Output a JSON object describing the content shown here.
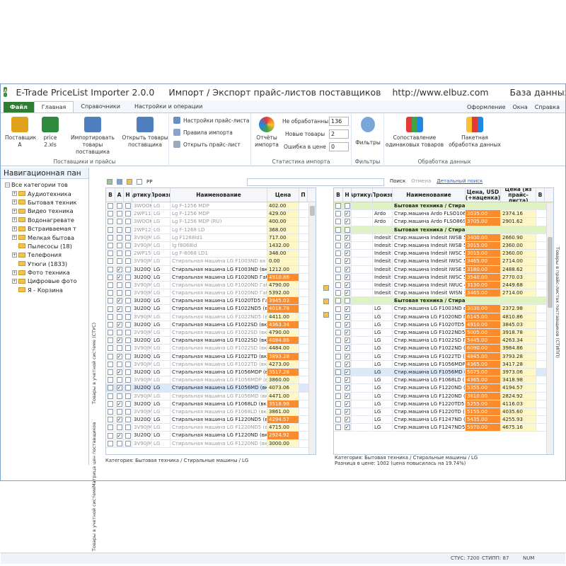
{
  "title": {
    "app": "E-Trade PriceList Importer 2.0.0",
    "subtitle": "Импорт / Экспорт прайс-листов поставщиков",
    "url": "http://www.elbuz.com",
    "db": "База данных: DE"
  },
  "tabs": {
    "file": "Файл",
    "main": "Главная",
    "ref": "Справочники",
    "settings": "Настройки и операции"
  },
  "rightmenu": {
    "design": "Оформление",
    "windows": "Окна",
    "help": "Справка"
  },
  "ribbon": {
    "g1": {
      "label": "Поставщики и прайсы",
      "supplier": "Поставщик",
      "supplier2": "А",
      "price": "price",
      "price2": "2.xls",
      "import": "Импортировать",
      "import2": "товары поставщика",
      "open": "Открыть товары",
      "open2": "поставщика"
    },
    "g2": {
      "label": "",
      "s1": "Настройки прайс-листа",
      "s2": "Правила импорта",
      "s3": "Открыть прайс-лист"
    },
    "g3": {
      "label": "Статистика импорта",
      "reports": "Отчёты",
      "reports2": "импорта",
      "n1": "Не обработанны",
      "v1": "136",
      "n2": "Новые товары",
      "v2": "2",
      "n3": "Ошибка в цене",
      "v3": "0"
    },
    "g4": {
      "label": "Фильтры",
      "filters": "Фильтры"
    },
    "g5": {
      "label": "Обработка данных",
      "compare": "Сопоставление",
      "compare2": "одинаковых товаров",
      "batch": "Пакетная",
      "batch2": "обработка данных"
    }
  },
  "nav": {
    "header": "Навигационная пан",
    "items": [
      "Все категории тов",
      "Аудиотехника",
      "Бытовая техник",
      "Видео техника",
      "Водонагревате",
      "Встраиваемая т",
      "Мелкая бытова",
      "Пылесосы (18)",
      "Телефония",
      "Утюги (1833)",
      "Фото техника",
      "Цифровые фото",
      "Я - Корзина"
    ]
  },
  "vtabs": {
    "t1": "Товары в учетной системе (СТУС)",
    "t2": "Матрица цен поставщиков",
    "t3": "Товары в учетной системе",
    "t4": "Товары в прайс-листах поставщиков (СТИПП)"
  },
  "left": {
    "pp": "PP",
    "headers": {
      "v": "В",
      "a": "А",
      "n": "Н",
      "art": "Артикул",
      "prod": "Произв",
      "name": "Наименование",
      "price": "Цена",
      "p": "П"
    },
    "rows": [
      [
        "3WOOKG",
        "LG",
        "Lg F-1256 MDP",
        "402.00",
        "g"
      ],
      [
        "2WP11Q",
        "LG",
        "Lg F-1256 MDP",
        "429.00",
        "g"
      ],
      [
        "3WOOKG",
        "LG",
        "Lg F-1256 MDP (RU)",
        "400.00",
        "g"
      ],
      [
        "2WP125",
        "LG",
        "Lg F-1268 LD",
        "368.00",
        "g"
      ],
      [
        "3V90JM",
        "LG",
        "Lg F1268ld1",
        "717.00",
        "g"
      ],
      [
        "3V90JM",
        "LG",
        "lg f8068ld",
        "1432.00",
        "g"
      ],
      [
        "2WP15Q",
        "LG",
        "Lg F-8068 LD1",
        "348.00",
        "g"
      ],
      [
        "3V90JM",
        "LG",
        "Стиральная машина LG F1003ND вх",
        "0.00",
        "g"
      ],
      [
        "3U20Q7",
        "LG",
        "Стиральная машина LG F1003ND (вкыг\"),с",
        "1212.00",
        "n"
      ],
      [
        "3U20Q7",
        "LG",
        "Стиральная машина LG F1020ND Габарит",
        "4910.86",
        "o"
      ],
      [
        "3V90JM",
        "LG",
        "Стиральная машина LG F1020ND Габарит",
        "4790.00",
        "g"
      ],
      [
        "3V90JM",
        "LG",
        "Стиральная машина LG F1020ND Габарит",
        "5392.00",
        "g"
      ],
      [
        "3U20Q7",
        "LG",
        "Стиральная машина LG F1020TD5 Габарит",
        "3945.03",
        "o"
      ],
      [
        "3U20Q7",
        "LG",
        "Стиральная машина LG F1022ND5 (вкыг\")",
        "4018.78",
        "o"
      ],
      [
        "3V90JM",
        "LG",
        "Стиральная машина LG F1022ND5 (вкыг\")",
        "4411.00",
        "g"
      ],
      [
        "3U20Q7",
        "LG",
        "Стиральная машина LG F1022SD (вкыг\"),с",
        "4363.34",
        "o"
      ],
      [
        "3V90JM",
        "LG",
        "Стиральная машина LG F1022SD (вкыг\"),с",
        "4790.00",
        "g"
      ],
      [
        "3U20Q7",
        "LG",
        "Стиральная машина LG F1022SD (вкыг\"),с",
        "4084.86",
        "o"
      ],
      [
        "3V90JM",
        "LG",
        "Стиральная машина LG F1022SD (вкыг\"),с",
        "4484.00",
        "g"
      ],
      [
        "3U20Q7",
        "LG",
        "Стиральная машина LG F1022TD (вкыг\"),с",
        "3893.28",
        "o"
      ],
      [
        "3V90JM",
        "LG",
        "Стиральная машина LG F1022TD (вкыг\"),с",
        "4273.00",
        "g"
      ],
      [
        "3U20Q7",
        "LG",
        "Стиральная машина LG F1056MDP (вкыг\"),",
        "3517.28",
        "o"
      ],
      [
        "3V90JM",
        "LG",
        "Стиральная машина LG F1056MDP (вкыг\")",
        "3860.00",
        "g"
      ],
      [
        "3U20Q7",
        "LG",
        "Стиральная машина LG F1056MD (вкыг\"),",
        "4073.06",
        "s"
      ],
      [
        "3V90JM",
        "LG",
        "Стиральная машина LG F1056MD (вкыг\"),",
        "4471.00",
        "g"
      ],
      [
        "3U20Q7",
        "LG",
        "Стиральная машина LG F1068LD (вкыг\"),",
        "3518.98",
        "o"
      ],
      [
        "3V90JM",
        "LG",
        "Стиральная машина LG F1068LD (вкыг\"),",
        "3861.00",
        "g"
      ],
      [
        "3U20Q7",
        "LG",
        "Стиральная машина LG F1220ND5 (вкыг\")",
        "4294.57",
        "o"
      ],
      [
        "3V90JM",
        "LG",
        "Стиральная машина LG F1220ND5 (вкыг\")",
        "4715.00",
        "g"
      ],
      [
        "3U20Q7",
        "LG",
        "Стиральная машина LG F1220ND (вкыг\"),",
        "2924.92",
        "o"
      ],
      [
        "3V90JM",
        "LG",
        "Стиральная машина LG F1220ND (вкыг\"),",
        "3000.00",
        "g"
      ]
    ],
    "status": "Категория: Бытовая техника / Стиральные машины / LG"
  },
  "mid": {
    "search": "Поиск",
    "cancel": "Отмена",
    "adv": "Детальный поиск"
  },
  "right": {
    "headers": {
      "v": "В",
      "n": "Н",
      "art": "Артикул",
      "prod": "Произв",
      "name": "Наименование",
      "usd": "Цена, USD (+наценка)",
      "price": "Цена (из прайс-листа)",
      "b": "В"
    },
    "rows": [
      [
        "",
        "",
        "Бытовая техника / Стира",
        "",
        "",
        "c"
      ],
      [
        "",
        "Ardo",
        "Стир.машина Ardo FLSO106L г",
        "3035.00",
        "2374.16",
        "n"
      ],
      [
        "",
        "Ardo",
        "Стир.машина Ardo FLSO86S Га",
        "3705.00",
        "2901.62",
        "n"
      ],
      [
        "",
        "",
        "Бытовая техника / Стира",
        "",
        "",
        "c"
      ],
      [
        "",
        "Indesit",
        "Стир.машина Indesit IWSB 50E",
        "3400.00",
        "2660.90",
        "n"
      ],
      [
        "",
        "Indesit",
        "Стир.машина Indesit IWSB 51C",
        "3015.00",
        "2360.00",
        "n"
      ],
      [
        "",
        "Indesit",
        "Стир.машина Indesit IWSC 50E",
        "3015.00",
        "2360.00",
        "n"
      ],
      [
        "",
        "Indesit",
        "Стир.машина Indesit IWSC 51C",
        "3465.00",
        "2714.00",
        "n"
      ],
      [
        "",
        "Indesit",
        "Стир.машина Indesit IWSE 51C",
        "3180.00",
        "2488.62",
        "n"
      ],
      [
        "",
        "Indesit",
        "Стир.машина Indesit IWSC 51C",
        "3540.00",
        "2770.03",
        "n"
      ],
      [
        "",
        "Indesit",
        "Стир.машина Indesit IWUC 41C",
        "3130.00",
        "2449.68",
        "n"
      ],
      [
        "",
        "Indesit",
        "Стир.машина Indesit WISN 10C",
        "3465.00",
        "2714.00",
        "n"
      ],
      [
        "",
        "",
        "Бытовая техника / Стира",
        "",
        "",
        "c"
      ],
      [
        "",
        "LG",
        "Стир.машина LG F1003ND вкы",
        "3030.00",
        "2372.98",
        "n"
      ],
      [
        "",
        "LG",
        "Стир.машина LG F1020ND Габ",
        "6145.00",
        "4810.86",
        "n"
      ],
      [
        "",
        "LG",
        "Стир.машина LG F1020TD5 Гс",
        "4910.00",
        "3845.03",
        "n"
      ],
      [
        "",
        "LG",
        "Стир.машина LG F1022ND5 (вкы",
        "5005.00",
        "3918.78",
        "n"
      ],
      [
        "",
        "LG",
        "Стир.машина LG F1022SD Габ",
        "5445.00",
        "4263.34",
        "n"
      ],
      [
        "",
        "LG",
        "Стир.машина LG F1022ND (вкы",
        "6090.00",
        "3984.86",
        "n"
      ],
      [
        "",
        "LG",
        "Стир.машина LG F1022TD (вкы",
        "4845.00",
        "3793.28",
        "n"
      ],
      [
        "",
        "LG",
        "Стир.машина LG F1056MDP (вкы",
        "4365.00",
        "3417.28",
        "n"
      ],
      [
        "",
        "LG",
        "Стир.машина LG F1056MD (вкь",
        "5075.00",
        "3973.06",
        "s"
      ],
      [
        "",
        "LG",
        "Стир.машина LG F1068LD (вк",
        "4365.00",
        "3418.98",
        "n"
      ],
      [
        "",
        "LG",
        "Стир.машина LG F1220ND (вкы",
        "5355.00",
        "4194.57",
        "n"
      ],
      [
        "",
        "LG",
        "Стир.машина LG F1220ND (вкы",
        "3610.00",
        "2824.92",
        "n"
      ],
      [
        "",
        "LG",
        "Стир.машина LG F1220TD5 (вк",
        "5255.00",
        "4116.03",
        "n"
      ],
      [
        "",
        "LG",
        "Стир.машина LG F1220TD (вк",
        "5155.00",
        "4035.60",
        "n"
      ],
      [
        "",
        "LG",
        "Стир.машина LG F1247ND (вк",
        "5435.00",
        "4255.93",
        "n"
      ],
      [
        "",
        "LG",
        "Стир.машина LG F1247ND5 (вк",
        "5970.00",
        "4675.16",
        "n"
      ]
    ],
    "status1": "Категория: Бытовая техника / Стиральные машины / LG",
    "status2": "Разница в цене: 1002  (цена повысилась на 19.74%)"
  },
  "statusbar": {
    "stus": "СТУС: 7200",
    "stipp": "СТИПП: 87",
    "num": "NUM"
  }
}
